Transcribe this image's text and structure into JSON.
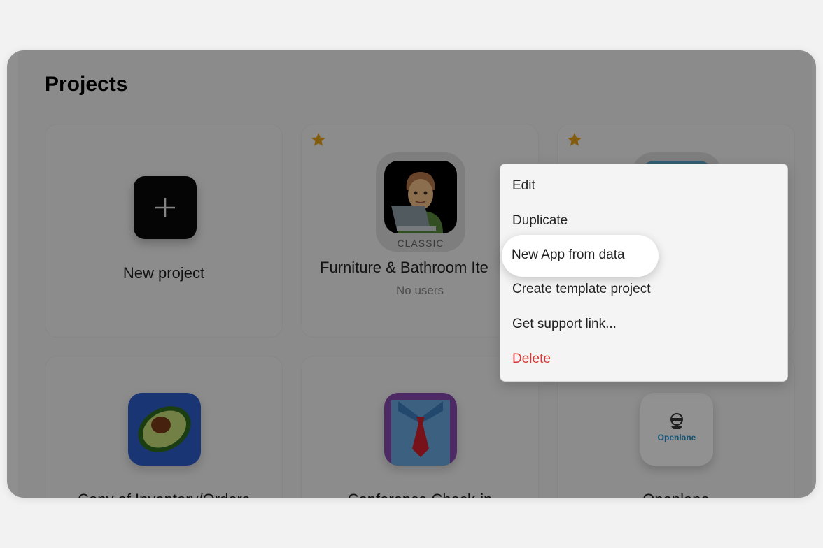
{
  "page": {
    "title": "Projects"
  },
  "new_project": {
    "label": "New project"
  },
  "projects": [
    {
      "name": "Furniture & Bathroom Ite",
      "users": "No users",
      "badge": "CLASSIC",
      "starred": true
    },
    {
      "name": "",
      "starred": true
    },
    {
      "name": "Copy of Inventory/Orders"
    },
    {
      "name": "Conference Check-in"
    },
    {
      "name": "Openlane",
      "logo_text": "Openlane"
    }
  ],
  "context_menu": {
    "items": [
      "Edit",
      "Duplicate",
      "New App from data",
      "Create template project",
      "Get support link...",
      "Delete"
    ]
  },
  "colors": {
    "star": "#e8a21a",
    "danger": "#d93636",
    "highlight_bg": "#ffffff"
  }
}
